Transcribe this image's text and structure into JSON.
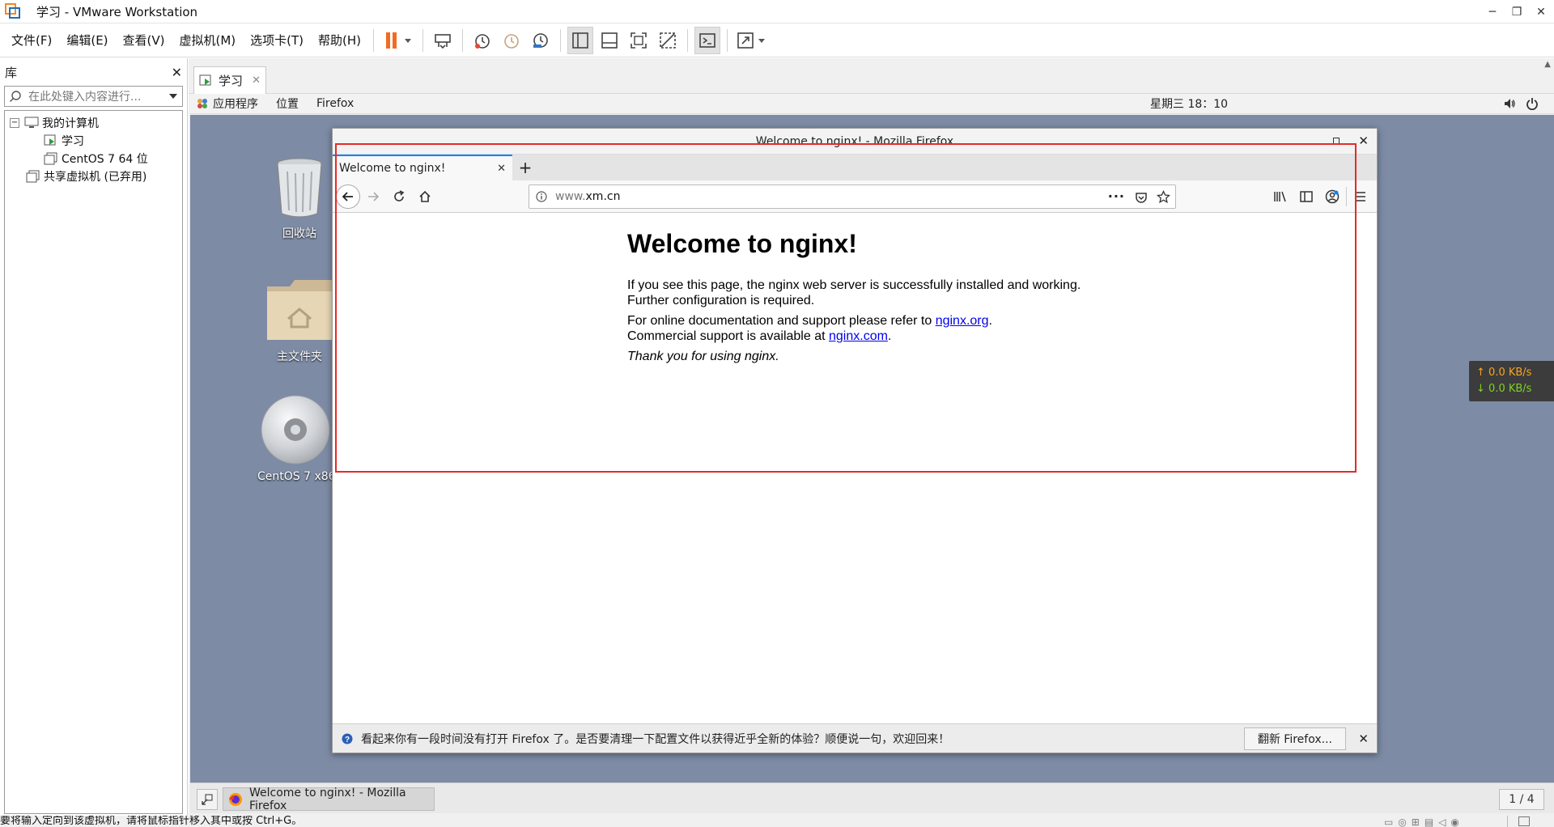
{
  "window": {
    "title": "学习 - VMware Workstation"
  },
  "menu": [
    "文件(F)",
    "编辑(E)",
    "查看(V)",
    "虚拟机(M)",
    "选项卡(T)",
    "帮助(H)"
  ],
  "library": {
    "title": "库",
    "search_placeholder": "在此处键入内容进行...",
    "tree": {
      "my_computer": "我的计算机",
      "vm1": "学习",
      "vm2": "CentOS 7 64 位",
      "shared": "共享虚拟机 (已弃用)"
    }
  },
  "vm_tab": {
    "label": "学习"
  },
  "gnome": {
    "apps": "应用程序",
    "places": "位置",
    "firefox": "Firefox",
    "clock": "星期三 18：10"
  },
  "desktop": {
    "trash": "回收站",
    "home": "主文件夹",
    "disc": "CentOS 7 x86_"
  },
  "firefox": {
    "window_title": "Welcome to nginx! - Mozilla Firefox",
    "tab_title": "Welcome to nginx!",
    "url_prefix": "www.",
    "url_domain": "xm.cn",
    "page": {
      "heading": "Welcome to nginx!",
      "p1_line1": "If you see this page, the nginx web server is successfully installed and working.",
      "p1_line2": "Further configuration is required.",
      "p2_line1_pre": "For online documentation and support please refer to ",
      "p2_link1": "nginx.org",
      "p2_line2_pre": "Commercial support is available at ",
      "p2_link2": "nginx.com",
      "p3": "Thank you for using nginx."
    },
    "notification": {
      "text": "看起来你有一段时间没有打开 Firefox 了。是否要清理一下配置文件以获得近乎全新的体验？顺便说一句，欢迎回来！",
      "button": "翻新 Firefox..."
    }
  },
  "netspeed": {
    "up": "0.0 KB/s",
    "down": "0.0 KB/s"
  },
  "taskbar": {
    "item": "Welcome to nginx! - Mozilla Firefox",
    "page_indicator": "1 / 4"
  },
  "status": {
    "text": "要将输入定向到该虚拟机，请将鼠标指针移入其中或按 Ctrl+G。"
  },
  "colors": {
    "highlight": "#e32b2b",
    "pause": "#f26b22",
    "desktop": "#7d8ba5",
    "link": "#0000ee"
  }
}
